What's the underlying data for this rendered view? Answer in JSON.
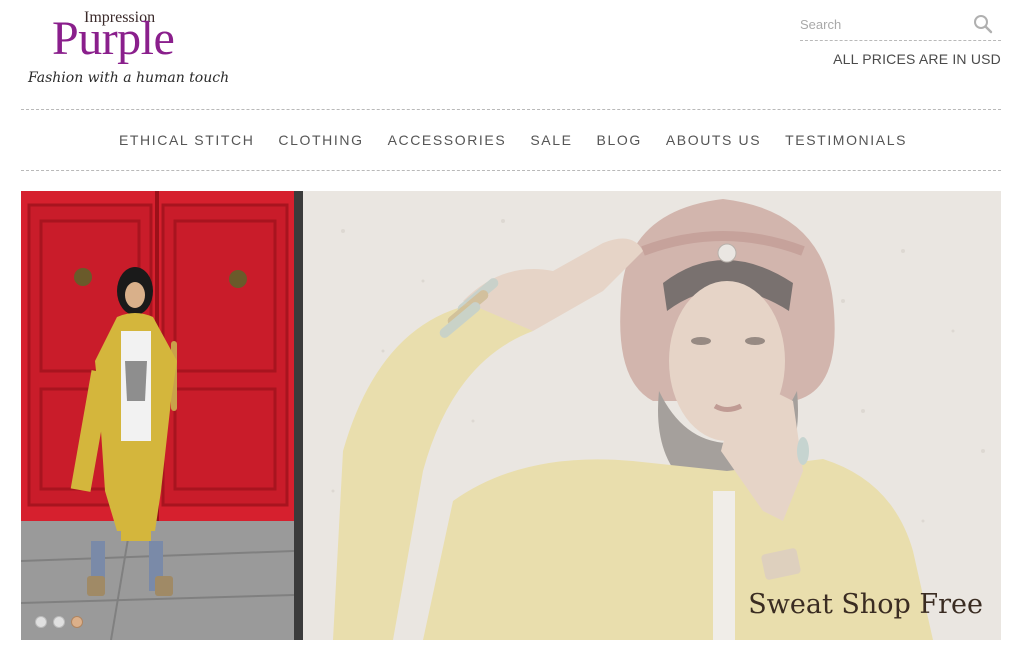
{
  "logo": {
    "small": "Impression",
    "big": "Purple",
    "tagline": "Fashion with a human touch"
  },
  "search": {
    "placeholder": "Search",
    "value": "",
    "icon": "search-icon"
  },
  "currency_note": "ALL PRICES ARE IN USD",
  "nav": [
    "ETHICAL STITCH",
    "CLOTHING",
    "ACCESSORIES",
    "SALE",
    "BLOG",
    "ABOUTS US",
    "TESTIMONIALS"
  ],
  "hero": {
    "caption": "Sweat Shop Free",
    "slides": 3,
    "active_slide": 3
  },
  "colors": {
    "brand": "#8a1f8c",
    "door_red": "#d6202e",
    "coat_yellow": "#d4b63c",
    "divider": "#3b3b3b"
  }
}
